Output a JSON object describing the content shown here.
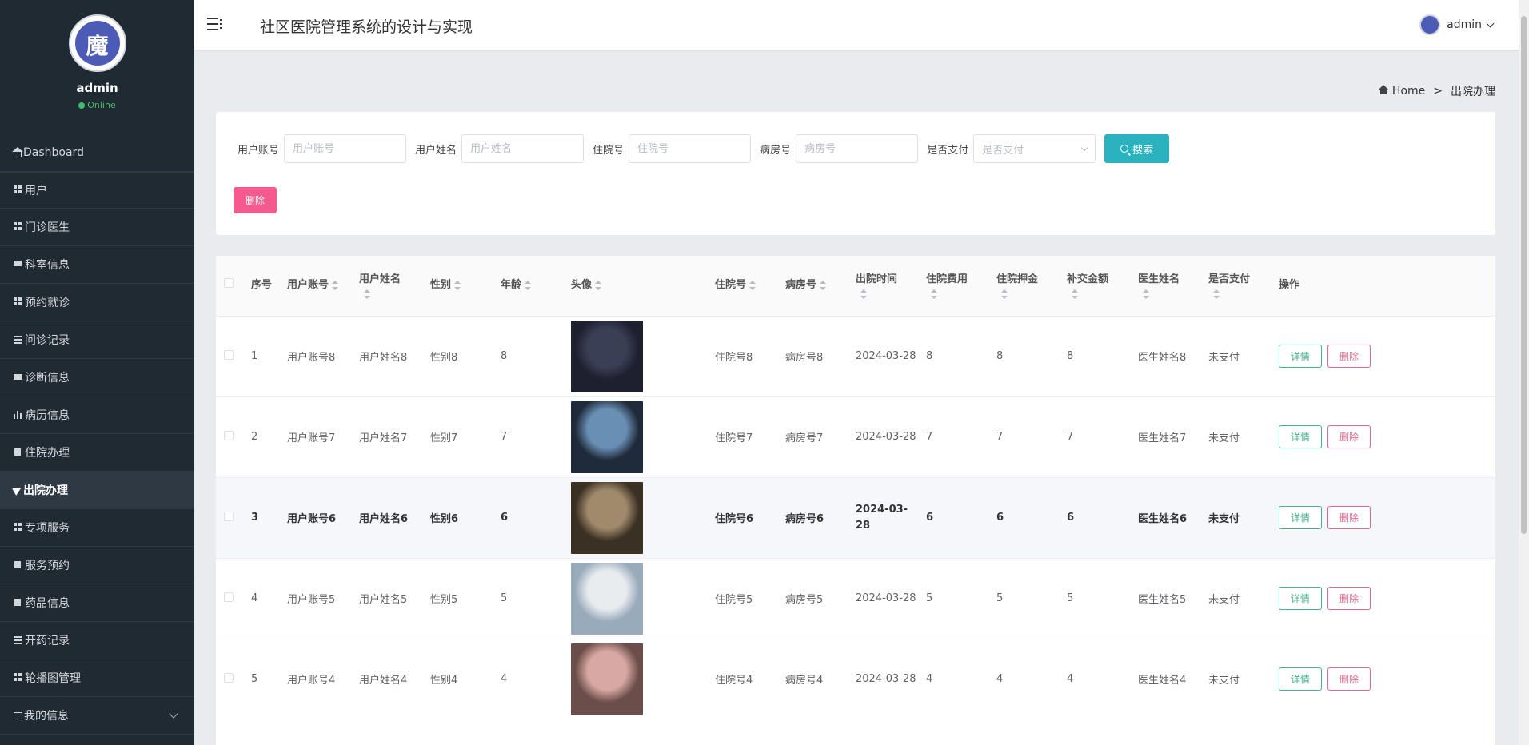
{
  "app": {
    "title": "社区医院管理系统的设计与实现"
  },
  "user": {
    "name": "admin",
    "status": "Online"
  },
  "sidebar": {
    "items": [
      {
        "label": "Dashboard",
        "icon": "home-icon"
      },
      {
        "label": "用户",
        "icon": "grid-icon"
      },
      {
        "label": "门诊医生",
        "icon": "grid-icon"
      },
      {
        "label": "科室信息",
        "icon": "chat-icon"
      },
      {
        "label": "预约就诊",
        "icon": "grid-icon"
      },
      {
        "label": "问诊记录",
        "icon": "list-icon"
      },
      {
        "label": "诊断信息",
        "icon": "card-icon"
      },
      {
        "label": "病历信息",
        "icon": "bar-chart-icon"
      },
      {
        "label": "住院办理",
        "icon": "cup-icon"
      },
      {
        "label": "出院办理",
        "icon": "paper-plane-icon"
      },
      {
        "label": "专项服务",
        "icon": "grid-icon"
      },
      {
        "label": "服务预约",
        "icon": "cup-icon"
      },
      {
        "label": "药品信息",
        "icon": "cup-icon"
      },
      {
        "label": "开药记录",
        "icon": "list-icon"
      },
      {
        "label": "轮播图管理",
        "icon": "grid-icon"
      },
      {
        "label": "我的信息",
        "icon": "user-card-icon"
      }
    ],
    "active_index": 9
  },
  "breadcrumb": {
    "home": "Home",
    "separator": ">",
    "current": "出院办理"
  },
  "search": {
    "fields": [
      {
        "label": "用户账号",
        "placeholder": "用户账号"
      },
      {
        "label": "用户姓名",
        "placeholder": "用户姓名"
      },
      {
        "label": "住院号",
        "placeholder": "住院号"
      },
      {
        "label": "病房号",
        "placeholder": "病房号"
      }
    ],
    "pay_label": "是否支付",
    "pay_placeholder": "是否支付",
    "search_button": "搜索",
    "delete_button": "删除"
  },
  "table": {
    "headers": {
      "index": "序号",
      "account": "用户账号",
      "name": "用户姓名",
      "gender": "性别",
      "age": "年龄",
      "avatar": "头像",
      "admission_no": "住院号",
      "ward_no": "病房号",
      "discharge_time": "出院时间",
      "fee": "住院费用",
      "deposit": "住院押金",
      "supplement": "补交金额",
      "doctor": "医生姓名",
      "paid": "是否支付",
      "actions": "操作"
    },
    "rows": [
      {
        "index": "1",
        "account": "用户账号8",
        "name": "用户姓名8",
        "gender": "性别8",
        "age": "8",
        "admission_no": "住院号8",
        "ward_no": "病房号8",
        "discharge_time": "2024-03-28",
        "fee": "8",
        "deposit": "8",
        "supplement": "8",
        "doctor": "医生姓名8",
        "paid": "未支付"
      },
      {
        "index": "2",
        "account": "用户账号7",
        "name": "用户姓名7",
        "gender": "性别7",
        "age": "7",
        "admission_no": "住院号7",
        "ward_no": "病房号7",
        "discharge_time": "2024-03-28",
        "fee": "7",
        "deposit": "7",
        "supplement": "7",
        "doctor": "医生姓名7",
        "paid": "未支付"
      },
      {
        "index": "3",
        "account": "用户账号6",
        "name": "用户姓名6",
        "gender": "性别6",
        "age": "6",
        "admission_no": "住院号6",
        "ward_no": "病房号6",
        "discharge_time": "2024-03-28",
        "fee": "6",
        "deposit": "6",
        "supplement": "6",
        "doctor": "医生姓名6",
        "paid": "未支付"
      },
      {
        "index": "4",
        "account": "用户账号5",
        "name": "用户姓名5",
        "gender": "性别5",
        "age": "5",
        "admission_no": "住院号5",
        "ward_no": "病房号5",
        "discharge_time": "2024-03-28",
        "fee": "5",
        "deposit": "5",
        "supplement": "5",
        "doctor": "医生姓名5",
        "paid": "未支付"
      },
      {
        "index": "5",
        "account": "用户账号4",
        "name": "用户姓名4",
        "gender": "性别4",
        "age": "4",
        "admission_no": "住院号4",
        "ward_no": "病房号4",
        "discharge_time": "2024-03-28",
        "fee": "4",
        "deposit": "4",
        "supplement": "4",
        "doctor": "医生姓名4",
        "paid": "未支付"
      }
    ],
    "detail_button": "详情",
    "delete_button": "删除"
  },
  "colors": {
    "sidebar_bg": "#202a33",
    "search_button": "#2ab3be",
    "delete_button": "#f45a8d",
    "detail_outline": "#44b28c",
    "delete_outline": "#e0678d",
    "online": "#3dbc6a"
  }
}
